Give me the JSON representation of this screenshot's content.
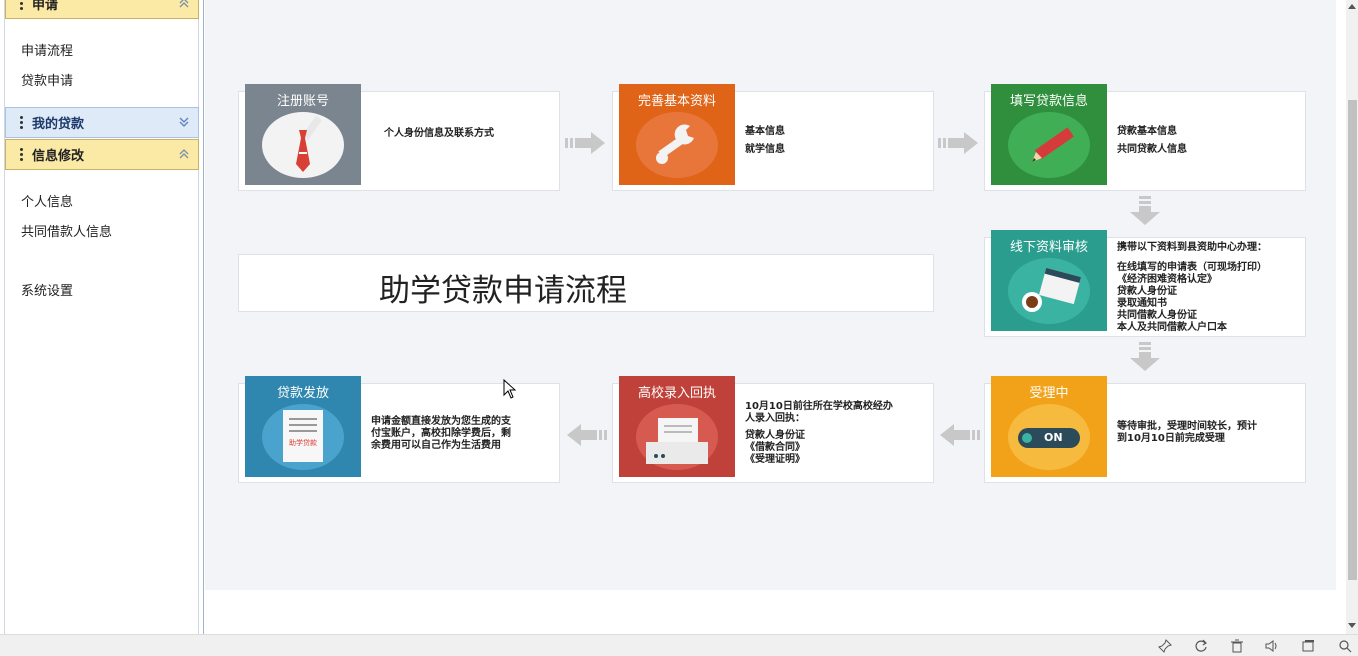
{
  "sidebar": {
    "sections": [
      {
        "label": "申请",
        "items": [
          "申请流程",
          "贷款申请"
        ]
      },
      {
        "label": "我的贷款",
        "items": []
      },
      {
        "label": "信息修改",
        "items": [
          "个人信息",
          "共同借款人信息"
        ]
      }
    ],
    "extra_item": "系统设置"
  },
  "main": {
    "title": "助学贷款申请流程",
    "steps": [
      {
        "title": "注册账号",
        "lines": [
          "个人身份信息及联系方式"
        ],
        "color": "#7b8590"
      },
      {
        "title": "完善基本资料",
        "lines": [
          "基本信息",
          "就学信息"
        ],
        "color": "#e06418"
      },
      {
        "title": "填写贷款信息",
        "lines": [
          "贷款基本信息",
          "共同贷款人信息"
        ],
        "color": "#2f8f3d"
      },
      {
        "title": "线下资料审核",
        "lines": [
          "携带以下资料到县资助中心办理：",
          "在线填写的申请表（可现场打印）",
          "《经济困难资格认定》",
          "贷款人身份证",
          "录取通知书",
          "共同借款人身份证",
          "本人及共同借款人户口本"
        ],
        "color": "#2a9d8f"
      },
      {
        "title": "受理中",
        "lines": [
          "等待审批，受理时间较长，预计",
          "到10月10日前完成受理"
        ],
        "color": "#f2a219",
        "badge": "ON"
      },
      {
        "title": "高校录入回执",
        "lines": [
          "10月10日前往所在学校高校经办",
          "人录入回执：",
          "贷款人身份证",
          "《借款合同》",
          "《受理证明》"
        ],
        "color": "#c0413a"
      },
      {
        "title": "贷款发放",
        "lines": [
          "申请金额直接发放为您生成的支",
          "付宝账户，高校扣除学费后，剩",
          "余费用可以自己作为生活费用"
        ],
        "color": "#2f87b0",
        "badge": "助学贷款"
      }
    ]
  },
  "taskbar": {
    "icons": [
      "pin-icon",
      "refresh-icon",
      "trash-icon",
      "volume-icon",
      "window-icon",
      "search-icon"
    ]
  }
}
